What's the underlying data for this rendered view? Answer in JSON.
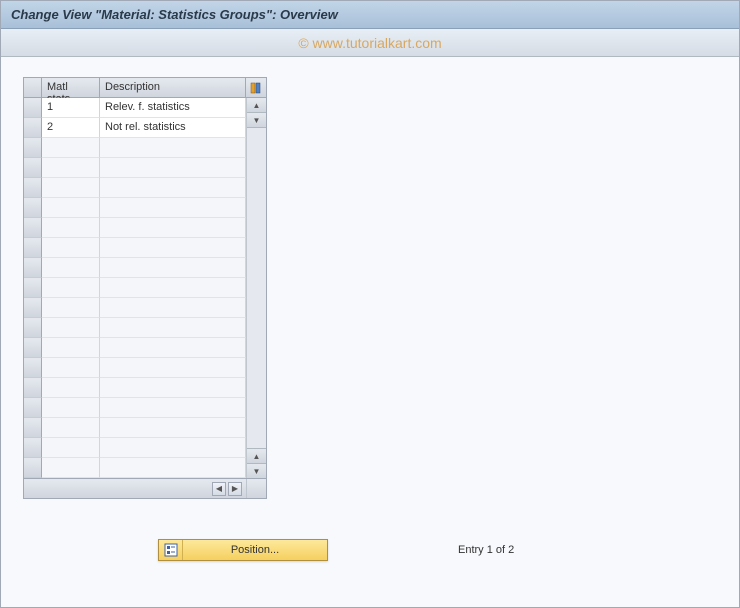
{
  "window_title": "Change View \"Material: Statistics Groups\": Overview",
  "watermark": "© www.tutorialkart.com",
  "grid": {
    "columns": {
      "matl_stats": "Matl stats",
      "description": "Description"
    },
    "rows": [
      {
        "matl_stats": "1",
        "description": "Relev. f. statistics"
      },
      {
        "matl_stats": "2",
        "description": "Not rel. statistics"
      }
    ],
    "empty_row_count": 17
  },
  "footer": {
    "position_button": "Position...",
    "entry_status": "Entry 1 of 2"
  }
}
